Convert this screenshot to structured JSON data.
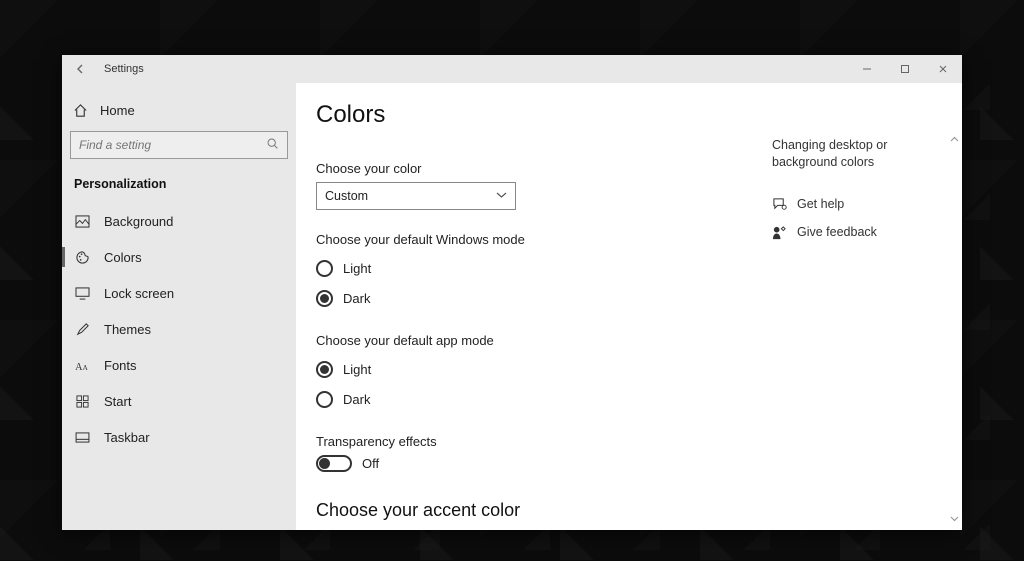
{
  "window": {
    "title": "Settings"
  },
  "sidebar": {
    "home": "Home",
    "search_placeholder": "Find a setting",
    "category": "Personalization",
    "items": [
      {
        "label": "Background"
      },
      {
        "label": "Colors"
      },
      {
        "label": "Lock screen"
      },
      {
        "label": "Themes"
      },
      {
        "label": "Fonts"
      },
      {
        "label": "Start"
      },
      {
        "label": "Taskbar"
      }
    ]
  },
  "main": {
    "heading": "Colors",
    "choose_color_label": "Choose your color",
    "choose_color_value": "Custom",
    "windows_mode_label": "Choose your default Windows mode",
    "windows_mode": {
      "light": "Light",
      "dark": "Dark",
      "selected": "dark"
    },
    "app_mode_label": "Choose your default app mode",
    "app_mode": {
      "light": "Light",
      "dark": "Dark",
      "selected": "light"
    },
    "transparency_label": "Transparency effects",
    "transparency_value": "Off",
    "accent_heading": "Choose your accent color"
  },
  "right": {
    "hint": "Changing desktop or background colors",
    "help": "Get help",
    "feedback": "Give feedback"
  }
}
